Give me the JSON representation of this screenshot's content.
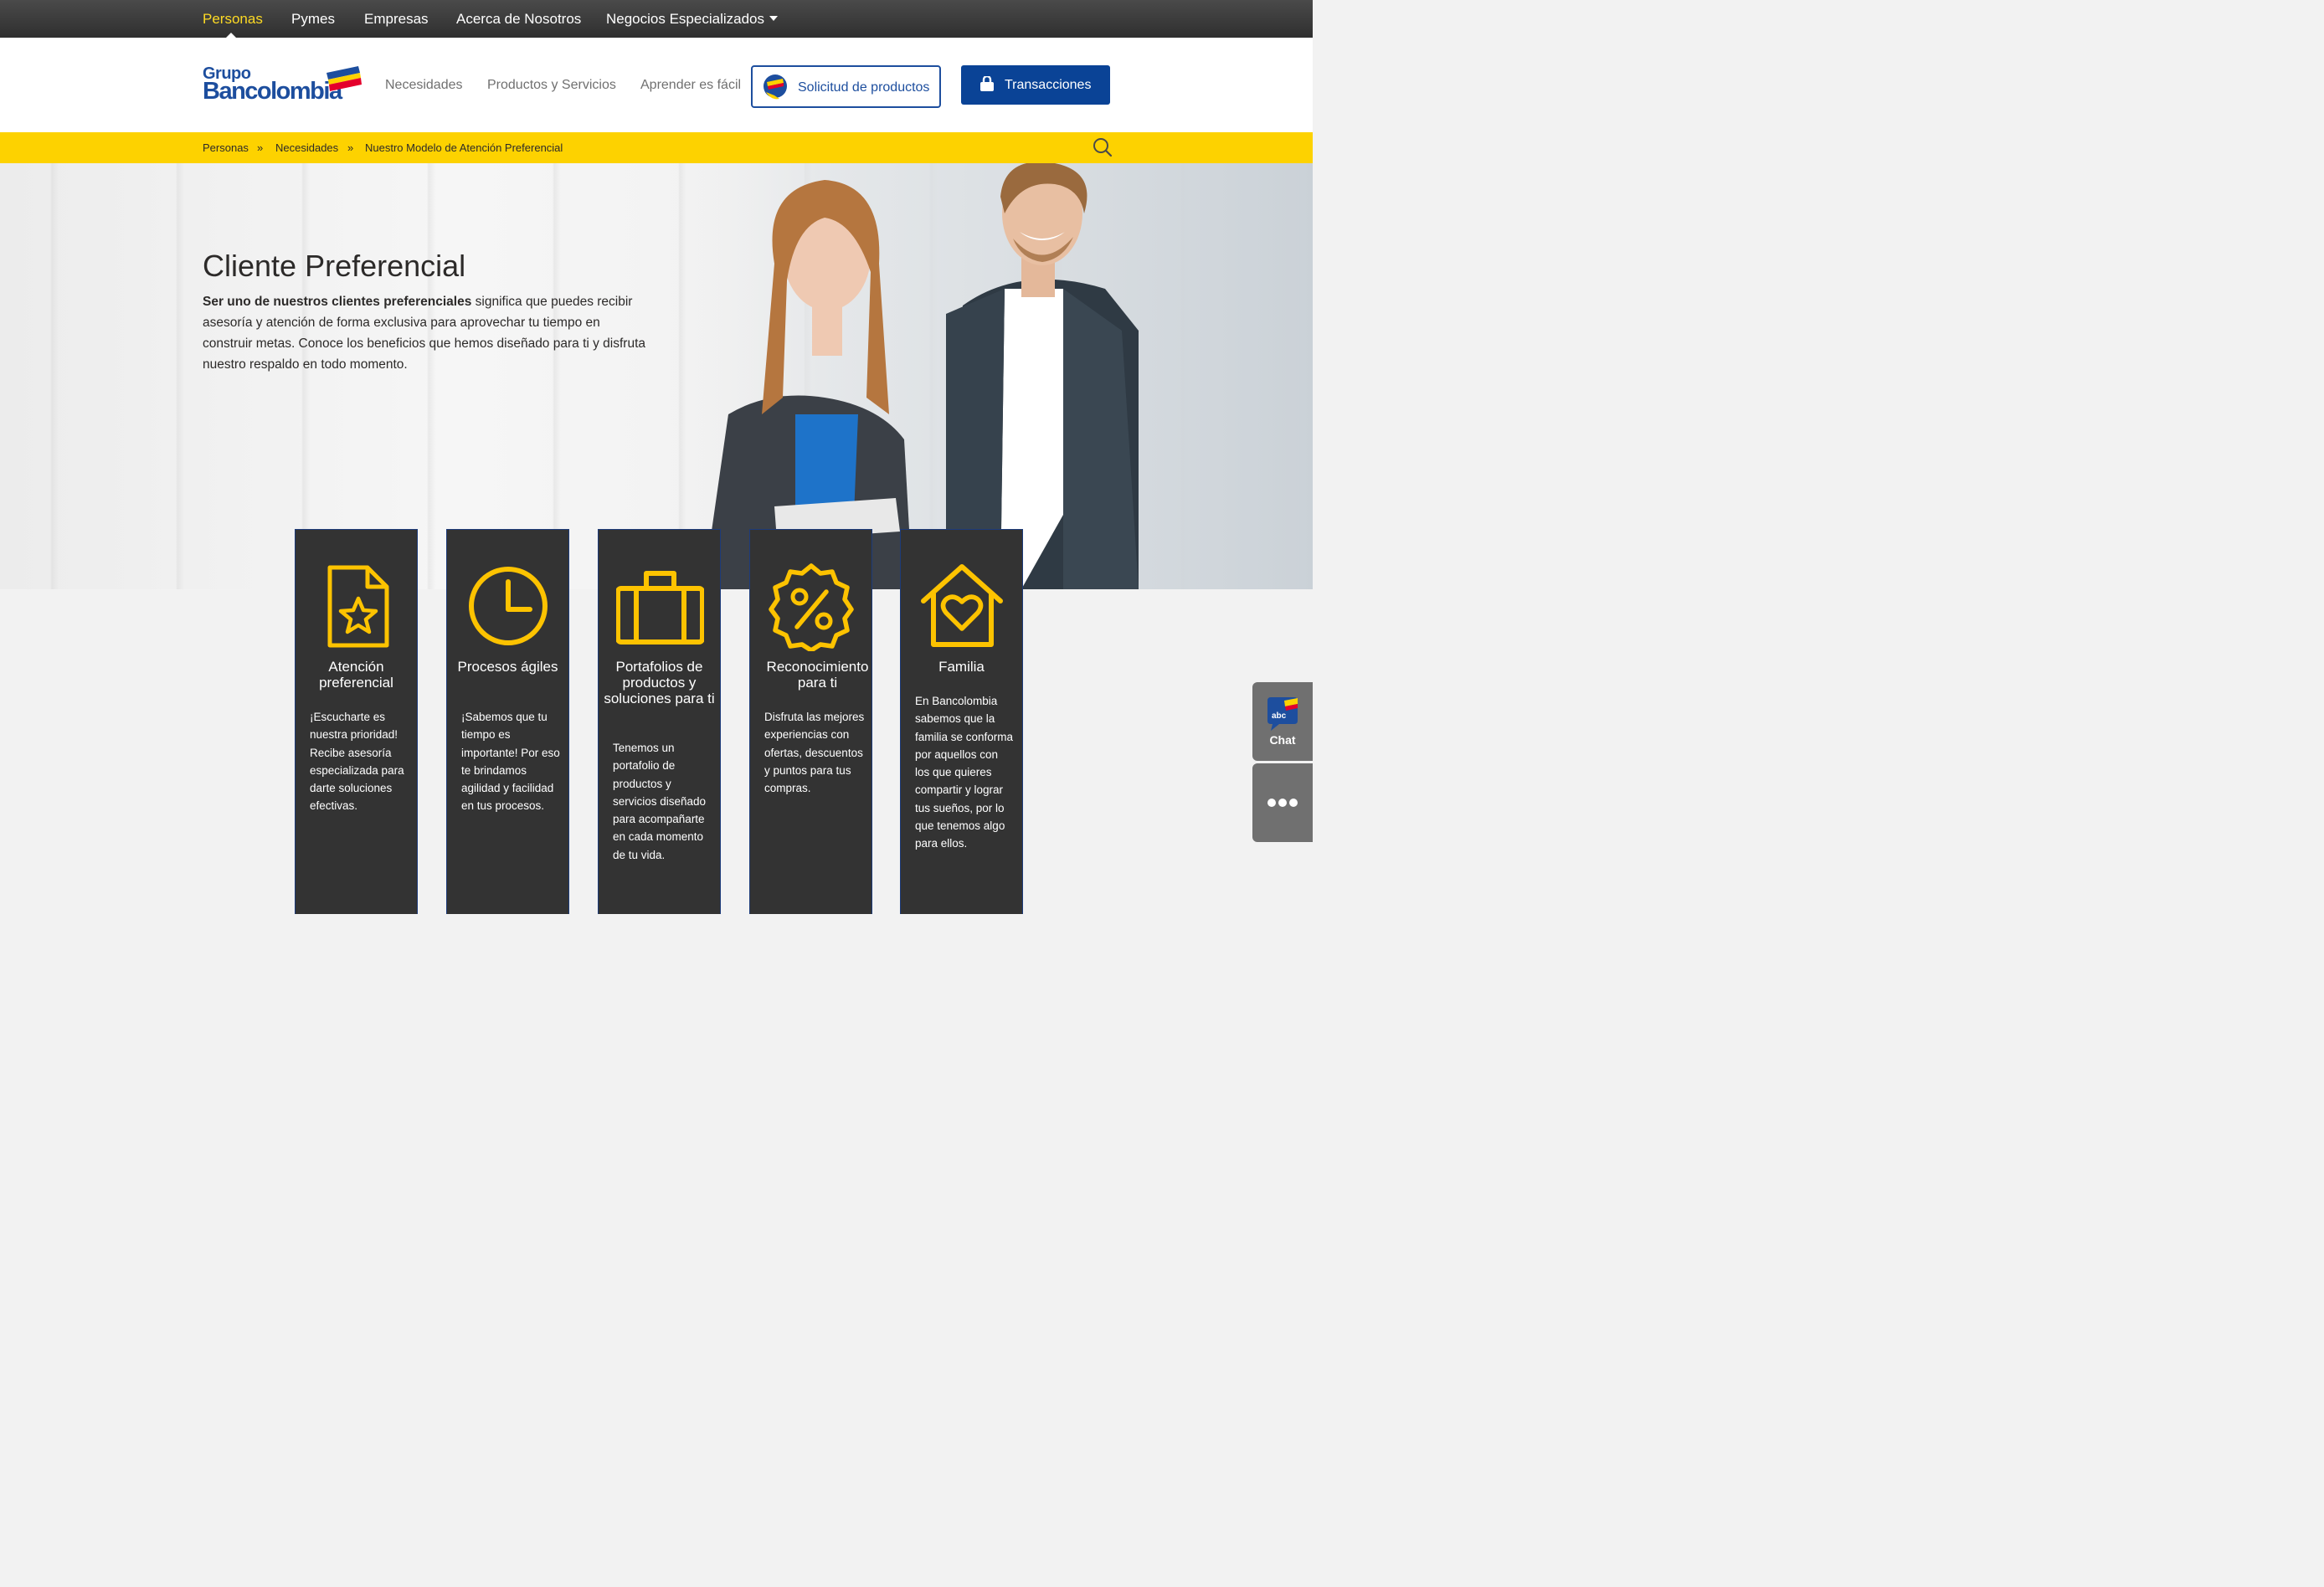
{
  "topbar": {
    "items": [
      "Personas",
      "Pymes",
      "Empresas",
      "Acerca de Nosotros",
      "Negocios Especializados"
    ],
    "active": "Personas"
  },
  "header": {
    "logo_line1": "Grupo",
    "logo_line2": "Bancolombia",
    "nav": [
      "Necesidades",
      "Productos y Servicios",
      "Aprender es fácil"
    ],
    "solicitud_label": "Solicitud de productos",
    "transacciones_label": "Transacciones"
  },
  "breadcrumb": {
    "items": [
      "Personas",
      "Necesidades",
      "Nuestro Modelo de Atención Preferencial"
    ],
    "separator": "»"
  },
  "hero": {
    "title": "Cliente Preferencial",
    "text_bold": "Ser uno de nuestros clientes preferenciales",
    "text_rest": " significa que puedes recibir asesoría y atención de forma exclusiva para aprovechar tu tiempo en construir metas. Conoce los beneficios que hemos diseñado para ti y disfruta nuestro respaldo en todo momento."
  },
  "cards": [
    {
      "icon": "star-document-icon",
      "title": "Atención preferencial",
      "text": "¡Escucharte es nuestra prioridad! Recibe asesoría especializada para darte soluciones efectivas."
    },
    {
      "icon": "clock-icon",
      "title": "Procesos ágiles",
      "text": "¡Sabemos que tu tiempo es importante! Por eso te brindamos agilidad y facilidad en tus procesos."
    },
    {
      "icon": "briefcase-icon",
      "title": "Portafolios de productos y soluciones para ti",
      "text": "Tenemos un portafolio de productos y servicios diseñado para acompañarte en cada momento de tu vida."
    },
    {
      "icon": "discount-badge-icon",
      "title": "Reconocimiento para ti",
      "text": "Disfruta las mejores experiencias con ofertas, descuentos y puntos para tus compras."
    },
    {
      "icon": "house-heart-icon",
      "title": "Familia",
      "text": "En Bancolombia sabemos que la familia se conforma por aquellos con los que quieres compartir y lograr tus sueños, por lo que tenemos algo para ellos."
    }
  ],
  "widgets": {
    "chat_badge": "abc",
    "chat_label": "Chat"
  },
  "colors": {
    "brand_blue": "#0a4396",
    "brand_yellow": "#fdd200",
    "card_bg": "#333333",
    "icon_yellow": "#fdc300"
  }
}
